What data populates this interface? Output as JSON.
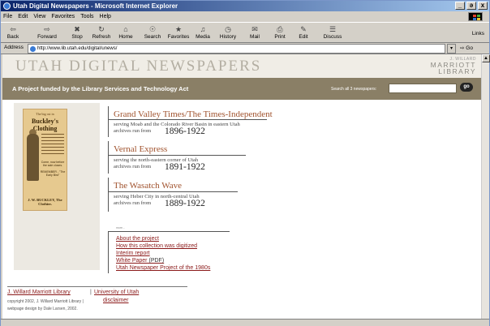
{
  "browser": {
    "window_title": "Utah Digital Newspapers - Microsoft Internet Explorer",
    "window_buttons": [
      "_",
      "ə",
      "x"
    ],
    "menu": [
      "File",
      "Edit",
      "View",
      "Favorites",
      "Tools",
      "Help"
    ],
    "toolbar": [
      {
        "label": "Back",
        "icon": "back-arrow-icon",
        "glyph": "⇦"
      },
      {
        "label": "Forward",
        "icon": "forward-arrow-icon",
        "glyph": "⇨"
      },
      {
        "label": "Stop",
        "icon": "stop-icon",
        "glyph": "✖"
      },
      {
        "label": "Refresh",
        "icon": "refresh-icon",
        "glyph": "↻"
      },
      {
        "label": "Home",
        "icon": "home-icon",
        "glyph": "⌂"
      },
      {
        "label": "Search",
        "icon": "search-icon",
        "glyph": "☉"
      },
      {
        "label": "Favorites",
        "icon": "favorites-icon",
        "glyph": "★"
      },
      {
        "label": "Media",
        "icon": "media-icon",
        "glyph": "♫"
      },
      {
        "label": "History",
        "icon": "history-icon",
        "glyph": "◷"
      },
      {
        "label": "Mail",
        "icon": "mail-icon",
        "glyph": "✉"
      },
      {
        "label": "Print",
        "icon": "print-icon",
        "glyph": "⎙"
      },
      {
        "label": "Edit",
        "icon": "edit-icon",
        "glyph": "✎"
      },
      {
        "label": "Discuss",
        "icon": "discuss-icon",
        "glyph": "☰"
      }
    ],
    "links_label": "Links",
    "address_label": "Address",
    "address_value": "http://www.lib.utah.edu/digital/unews/",
    "go_label": "Go"
  },
  "page": {
    "site_title": "UTAH DIGITAL NEWSPAPERS",
    "library_logo": [
      "J. WILLARD",
      "MARRIOTT",
      "LIBRARY"
    ],
    "tagline": "A Project funded by the Library Services and Technology Act",
    "search_label": "Search all 3 newspapers:",
    "search_value": "",
    "search_button": "go",
    "poster": {
      "top": "The big cut in",
      "name": "Buckley's Clothing",
      "sale": "Come, now before the sale closes.",
      "remember": "REMEMBER - \"The Early Bird\"",
      "bottom": "J. W. BUCKLEY, The Clothier."
    },
    "papers": [
      {
        "title": "Grand Valley Times/The Times-Independent",
        "serving": "serving Moab and the Colorado River Basin in eastern Utah",
        "archives": "archives run from",
        "years": "1896-1922"
      },
      {
        "title": "Vernal Express",
        "serving": "serving the north-eastern corner of Utah",
        "archives": "archives run from",
        "years": "1891-1922"
      },
      {
        "title": "The Wasatch Wave",
        "serving": "serving Heber City in north-central Utah",
        "archives": "archives run from",
        "years": "1889-1922"
      }
    ],
    "more_label": "more...",
    "more_links": [
      "About the project",
      "How this collection was digitized",
      "Interim report",
      "White Paper",
      "Utah Newspaper Project of the 1980s"
    ],
    "pdf_suffix": "(PDF)",
    "footer": {
      "link1": "J. Willard Marriott Library",
      "separator": "|",
      "link2": "University of Utah",
      "copyright": "copyright 2002, J. Willard Marriott Library |",
      "disclaimer": "disclaimer",
      "design": "webpage design by Dale Larsen, 2002."
    }
  }
}
